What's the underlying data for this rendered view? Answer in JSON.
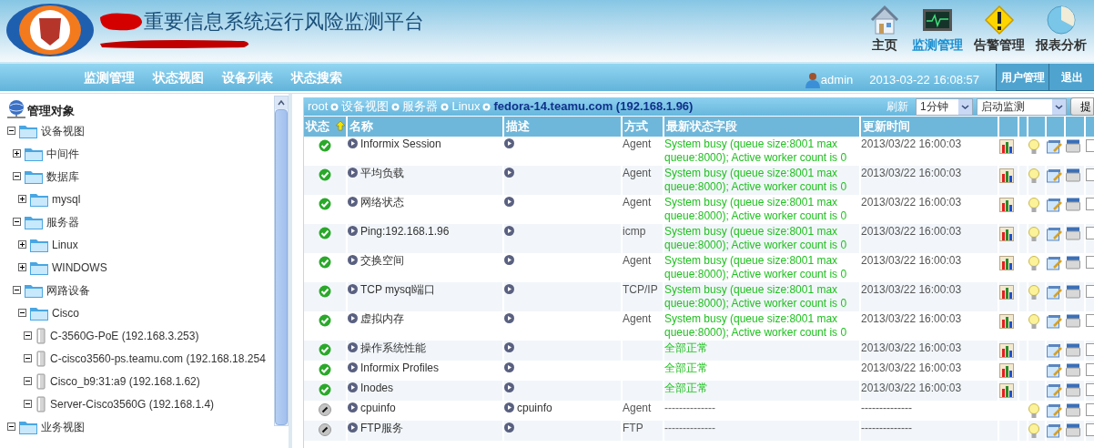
{
  "header": {
    "title": "重要信息系统运行风险监测平台",
    "modules": [
      {
        "label": "主页",
        "kind": "home",
        "selected": false
      },
      {
        "label": "监测管理",
        "kind": "monitor",
        "selected": true
      },
      {
        "label": "告警管理",
        "kind": "alert",
        "selected": false
      },
      {
        "label": "报表分析",
        "kind": "report",
        "selected": false
      }
    ]
  },
  "nav": {
    "items": [
      "监测管理",
      "状态视图",
      "设备列表",
      "状态搜索"
    ],
    "user": "admin",
    "datetime": "2013-03-22 16:08:57",
    "buttons": [
      "用户管理",
      "退出"
    ]
  },
  "tree": {
    "title": "管理对象",
    "nodes": [
      {
        "label": "设备视图",
        "kind": "folder",
        "expanded": true,
        "children": [
          {
            "label": "中间件",
            "kind": "folder",
            "expanded": false
          },
          {
            "label": "数据库",
            "kind": "folder",
            "expanded": true,
            "children": [
              {
                "label": "mysql",
                "kind": "folder",
                "expanded": false
              }
            ]
          },
          {
            "label": "服务器",
            "kind": "folder",
            "expanded": true,
            "children": [
              {
                "label": "Linux",
                "kind": "folder",
                "expanded": false
              },
              {
                "label": "WINDOWS",
                "kind": "folder",
                "expanded": false
              }
            ]
          },
          {
            "label": "网路设备",
            "kind": "folder",
            "expanded": true,
            "children": [
              {
                "label": "Cisco",
                "kind": "folder",
                "expanded": true,
                "children": [
                  {
                    "label": "C-3560G-PoE (192.168.3.253)",
                    "kind": "device",
                    "expanded": true
                  },
                  {
                    "label": "C-cisco3560-ps.teamu.com (192.168.18.254",
                    "kind": "device",
                    "expanded": true
                  },
                  {
                    "label": "Cisco_b9:31:a9 (192.168.1.62)",
                    "kind": "device",
                    "expanded": true
                  },
                  {
                    "label": "Server-Cisco3560G (192.168.1.4)",
                    "kind": "device",
                    "expanded": true
                  }
                ]
              }
            ]
          }
        ]
      },
      {
        "label": "业务视图",
        "kind": "folder",
        "expanded": true
      }
    ]
  },
  "breadcrumb": [
    "root",
    "设备视图",
    "服务器",
    "Linux",
    "fedora-14.teamu.com (192.168.1.96)"
  ],
  "toolbar": {
    "refresh_label": "刷新",
    "interval": "1分钟",
    "action": "启动监测",
    "submit": "提"
  },
  "table": {
    "columns": [
      "状态",
      "名称",
      "描述",
      "方式",
      "最新状态字段",
      "更新时间"
    ],
    "rows": [
      {
        "kind": "ok",
        "name": "Informix Session",
        "description": "",
        "method": "Agent",
        "latest": "System busy (queue size:8001 max queue:8000); Active worker count is 0",
        "time": "2013/03/22 16:00:03",
        "chart": true,
        "alert": true,
        "checked": false
      },
      {
        "kind": "ok",
        "name": "平均负载",
        "description": "",
        "method": "Agent",
        "latest": "System busy (queue size:8001 max queue:8000); Active worker count is 0",
        "time": "2013/03/22 16:00:03",
        "chart": true,
        "alert": true,
        "checked": false
      },
      {
        "kind": "ok",
        "name": "网络状态",
        "description": "",
        "method": "Agent",
        "latest": "System busy (queue size:8001 max queue:8000); Active worker count is 0",
        "time": "2013/03/22 16:00:03",
        "chart": true,
        "alert": true,
        "checked": false
      },
      {
        "kind": "ok",
        "name": "Ping:192.168.1.96",
        "description": "",
        "method": "icmp",
        "latest": "System busy (queue size:8001 max queue:8000); Active worker count is 0",
        "time": "2013/03/22 16:00:03",
        "chart": true,
        "alert": true,
        "checked": false
      },
      {
        "kind": "ok",
        "name": "交换空间",
        "description": "",
        "method": "Agent",
        "latest": "System busy (queue size:8001 max queue:8000); Active worker count is 0",
        "time": "2013/03/22 16:00:03",
        "chart": true,
        "alert": true,
        "checked": false
      },
      {
        "kind": "ok",
        "name": "TCP mysql端口",
        "description": "",
        "method": "TCP/IP",
        "latest": "System busy (queue size:8001 max queue:8000); Active worker count is 0",
        "time": "2013/03/22 16:00:03",
        "chart": true,
        "alert": true,
        "checked": false
      },
      {
        "kind": "ok",
        "name": "虚拟内存",
        "description": "",
        "method": "Agent",
        "latest": "System busy (queue size:8001 max queue:8000); Active worker count is 0",
        "time": "2013/03/22 16:00:03",
        "chart": true,
        "alert": true,
        "checked": false
      },
      {
        "kind": "ok",
        "name": "操作系统性能",
        "description": "",
        "method": "",
        "latest": "全部正常",
        "time": "2013/03/22 16:00:03",
        "chart": true,
        "alert": false,
        "checked": false
      },
      {
        "kind": "ok",
        "name": "Informix Profiles",
        "description": "",
        "method": "",
        "latest": "全部正常",
        "time": "2013/03/22 16:00:03",
        "chart": true,
        "alert": false,
        "checked": false
      },
      {
        "kind": "ok",
        "name": "Inodes",
        "description": "",
        "method": "",
        "latest": "全部正常",
        "time": "2013/03/22 16:00:03",
        "chart": true,
        "alert": false,
        "checked": false
      },
      {
        "kind": "disabled",
        "name": "cpuinfo",
        "description": "cpuinfo",
        "method": "Agent",
        "latest": "--------------",
        "time": "--------------",
        "chart": false,
        "alert": true,
        "checked": false
      },
      {
        "kind": "disabled",
        "name": "FTP服务",
        "description": "",
        "method": "FTP",
        "latest": "--------------",
        "time": "--------------",
        "chart": false,
        "alert": true,
        "checked": false
      }
    ]
  }
}
